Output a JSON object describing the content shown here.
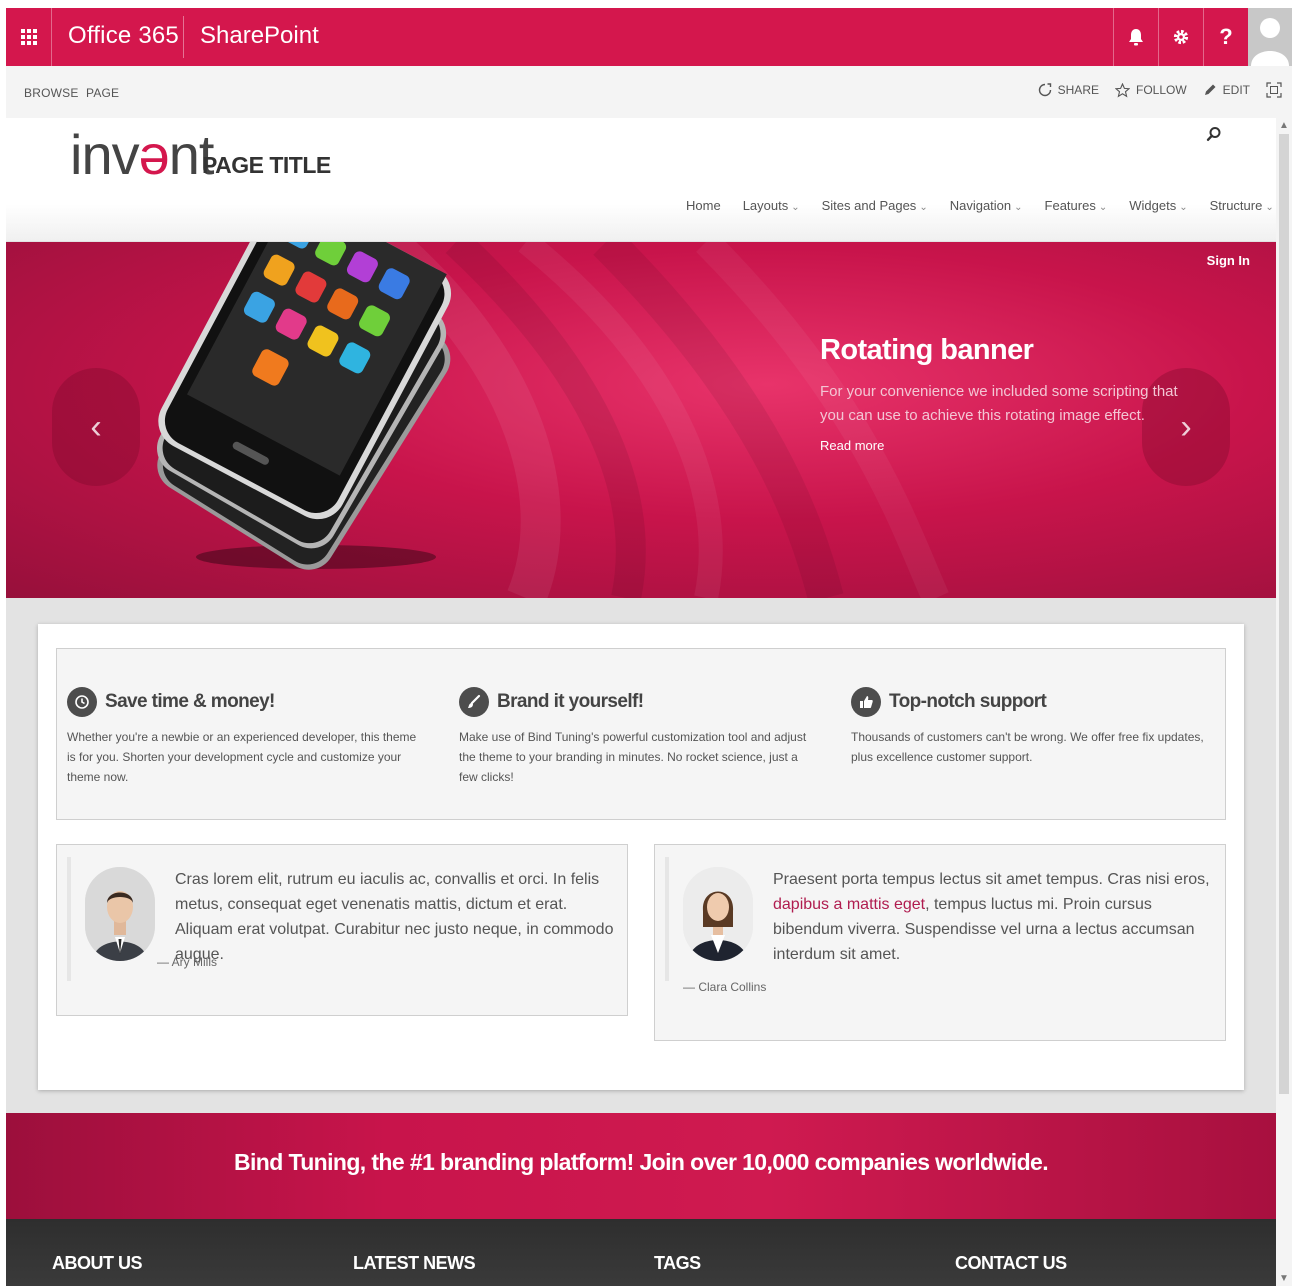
{
  "suite_bar": {
    "app_name": "Office 365",
    "product_name": "SharePoint",
    "icons": [
      "bell-icon",
      "gear-icon",
      "help-icon"
    ],
    "help_glyph": "?",
    "accent_color": "#d4174d"
  },
  "ribbon": {
    "tabs": [
      "BROWSE",
      "PAGE"
    ],
    "actions": [
      {
        "label": "SHARE",
        "icon": "share-icon"
      },
      {
        "label": "FOLLOW",
        "icon": "star-icon"
      },
      {
        "label": "EDIT",
        "icon": "pencil-icon"
      }
    ]
  },
  "header": {
    "logo_text_before": "inv",
    "logo_text_accent": "ə",
    "logo_text_after": "nt",
    "page_title": "PAGE TITLE",
    "nav": [
      {
        "label": "Home",
        "has_menu": false
      },
      {
        "label": "Layouts",
        "has_menu": true
      },
      {
        "label": "Sites and Pages",
        "has_menu": true
      },
      {
        "label": "Navigation",
        "has_menu": true
      },
      {
        "label": "Features",
        "has_menu": true
      },
      {
        "label": "Widgets",
        "has_menu": true
      },
      {
        "label": "Structure",
        "has_menu": true
      }
    ],
    "chevron": "⌄"
  },
  "banner": {
    "sign_in": "Sign In",
    "title": "Rotating banner",
    "text": "For your convenience we included some scripting that you can use to achieve this rotating image effect.",
    "link": "Read more",
    "prev_glyph": "‹",
    "next_glyph": "›"
  },
  "features": [
    {
      "icon": "clock-icon",
      "title": "Save time & money!",
      "text": "Whether you're a newbie or an experienced developer, this theme is for you. Shorten your development cycle and customize your theme now."
    },
    {
      "icon": "brush-icon",
      "title": "Brand it yourself!",
      "text": "Make use of Bind Tuning's powerful customization tool and adjust the theme to your branding in minutes. No rocket science, just a few clicks!"
    },
    {
      "icon": "thumbs-up-icon",
      "title": "Top-notch support",
      "text": "Thousands of customers can't be wrong. We offer free fix updates, plus excellence customer support."
    }
  ],
  "testimonials": [
    {
      "text": "Cras lorem elit, rutrum eu iaculis ac, convallis et orci. In felis metus, consequat eget venenatis mattis, dictum et erat. Aliquam erat volutpat. Curabitur nec justo neque, in commodo augue.",
      "author": "— Ary Mills"
    },
    {
      "text_before": "Praesent porta tempus lectus sit amet tempus. Cras nisi eros, ",
      "link": "dapibus a mattis eget",
      "text_after": ", tempus luctus mi. Proin cursus bibendum viverra. Suspendisse vel urna a lectus accumsan interdum sit amet.",
      "author": "— Clara Collins"
    }
  ],
  "cta": {
    "text": "Bind Tuning, the #1 branding platform! Join over 10,000 companies worldwide."
  },
  "footer": {
    "columns": [
      "ABOUT US",
      "LATEST NEWS",
      "TAGS",
      "CONTACT US"
    ]
  }
}
